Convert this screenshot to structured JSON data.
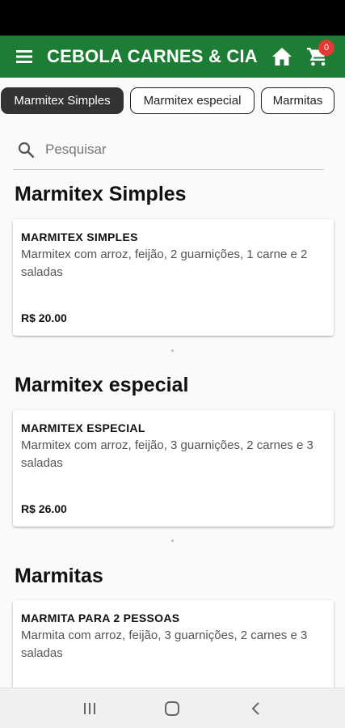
{
  "app": {
    "title": "CEBOLA CARNES & CIA",
    "cart_count": "0",
    "colors": {
      "app_bar": "#1e7d34",
      "badge": "#e53935",
      "chip_active": "#333333"
    }
  },
  "categories": [
    {
      "label": "Marmitex Simples",
      "active": true
    },
    {
      "label": "Marmitex especial",
      "active": false
    },
    {
      "label": "Marmitas",
      "active": false
    }
  ],
  "search": {
    "placeholder": "Pesquisar",
    "value": ""
  },
  "sections": [
    {
      "title": "Marmitex Simples",
      "item": {
        "name": "MARMITEX SIMPLES",
        "description": "Marmitex com arroz, feijão, 2 guarnições, 1 carne e 2 saladas",
        "price": "R$ 20.00"
      }
    },
    {
      "title": "Marmitex especial",
      "item": {
        "name": "MARMITEX ESPECIAL",
        "description": "Marmitex com arroz, feijão, 3 guarnições, 2 carnes e 3 saladas",
        "price": "R$ 26.00"
      }
    },
    {
      "title": "Marmitas",
      "item": {
        "name": "MARMITA PARA 2 PESSOAS",
        "description": "Marmita com arroz, feijão, 3 guarnições, 2 carnes e 3 saladas",
        "price": ""
      }
    }
  ],
  "icons": {
    "menu": "menu-icon",
    "home": "home-icon",
    "cart": "cart-icon",
    "search": "search-icon",
    "nav_recents": "recents-icon",
    "nav_home": "nav-home-icon",
    "nav_back": "back-icon"
  }
}
